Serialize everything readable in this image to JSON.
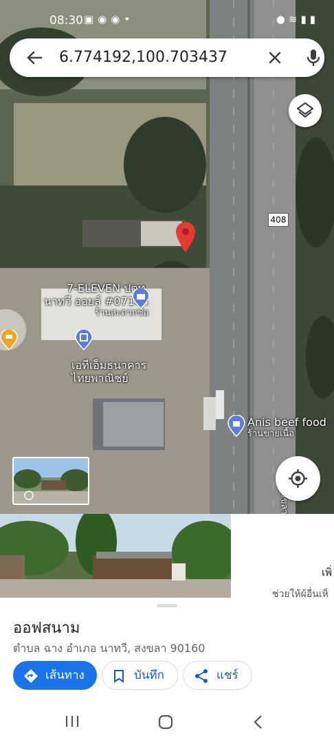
{
  "status_bar": {
    "time": "08:30",
    "left_icons": [
      "gallery-icon",
      "messenger-icon",
      "line-icon",
      "dot-icon"
    ],
    "right_icons": [
      "location-icon",
      "wifi-icon",
      "signal-icon",
      "battery-icon"
    ]
  },
  "search": {
    "query": "6.774192,100.703437",
    "icons": [
      "back-arrow-icon",
      "close-icon",
      "mic-icon"
    ]
  },
  "map": {
    "route_shield": "408",
    "pois": [
      {
        "name": "7-ELEVEN ปตท.\nนาทวี ออยล์ #07164",
        "category": "ร้านสะดวกซื้อ",
        "icon": "shop-icon"
      },
      {
        "name": "เอทีเอ็มธนาคาร\nไทยพาณิชย์",
        "icon": "bank-icon"
      },
      {
        "name": "Anis beef food",
        "category": "ร้านขายเนื้อ",
        "icon": "shopping-bag-icon"
      }
    ],
    "buttons": [
      "layers-icon",
      "my-location-icon"
    ],
    "road_side_label": "สงขลา"
  },
  "photos": {
    "right_text_1": "เพิ่",
    "right_text_2": "ช่วยให้ผู้อื่นเห็"
  },
  "place": {
    "title": "ออฟสนาม",
    "address": "ตำบล ฉาง อำเภอ นาทวี, สงขลา 90160",
    "actions": {
      "directions": "เส้นทาง",
      "save": "บันทึก",
      "share": "แชร์"
    }
  },
  "nav_bar": [
    "recent-apps-icon",
    "home-icon",
    "back-icon"
  ],
  "colors": {
    "primary_blue": "#1a73e8",
    "pin_red": "#e53935",
    "poi_blue": "#5b7de0"
  }
}
